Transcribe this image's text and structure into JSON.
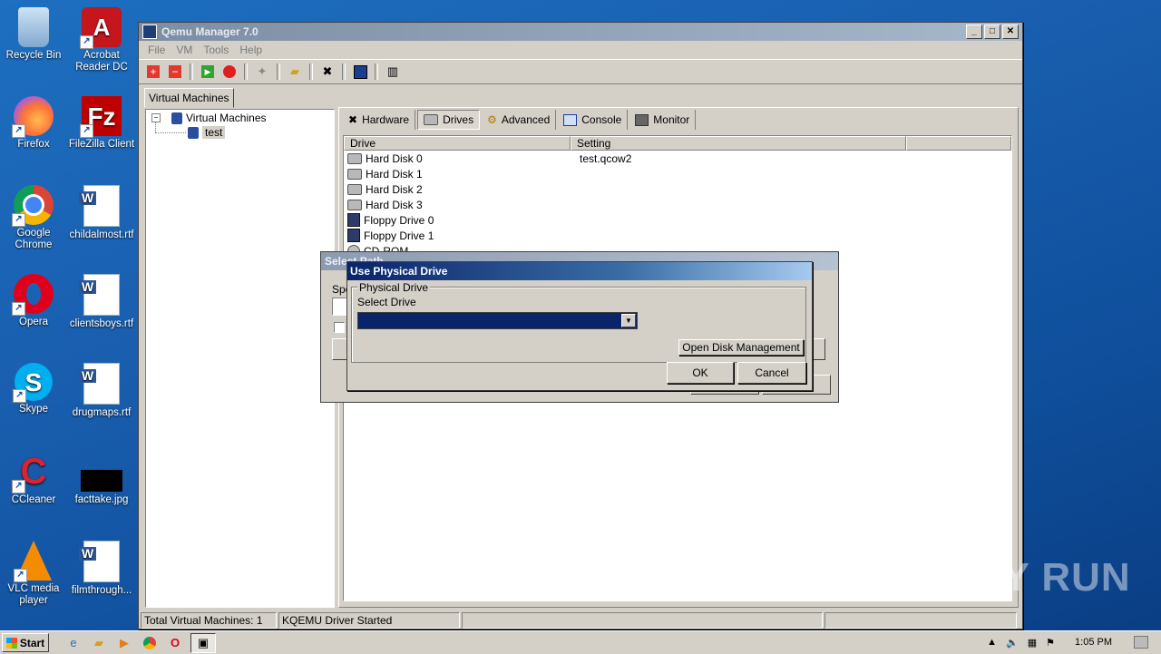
{
  "desktop": {
    "icons": [
      {
        "label": "Recycle Bin",
        "icon": "recycle-bin-icon"
      },
      {
        "label": "Acrobat Reader DC",
        "icon": "acrobat-icon"
      },
      {
        "label": "Firefox",
        "icon": "firefox-icon"
      },
      {
        "label": "FileZilla Client",
        "icon": "filezilla-icon"
      },
      {
        "label": "Google Chrome",
        "icon": "chrome-icon"
      },
      {
        "label": "childalmost.rtf",
        "icon": "word-doc-icon"
      },
      {
        "label": "Opera",
        "icon": "opera-icon"
      },
      {
        "label": "clientsboys.rtf",
        "icon": "word-doc-icon"
      },
      {
        "label": "Skype",
        "icon": "skype-icon"
      },
      {
        "label": "drugmaps.rtf",
        "icon": "word-doc-icon"
      },
      {
        "label": "CCleaner",
        "icon": "ccleaner-icon"
      },
      {
        "label": "facttake.jpg",
        "icon": "image-file-icon"
      },
      {
        "label": "VLC media player",
        "icon": "vlc-icon"
      },
      {
        "label": "filmthrough...",
        "icon": "word-doc-icon"
      }
    ]
  },
  "window": {
    "title": "Qemu Manager 7.0",
    "minimize": "_",
    "maximize": "□",
    "close": "✕",
    "menu": [
      "File",
      "VM",
      "Tools",
      "Help"
    ],
    "vm_tab": "Virtual Machines",
    "tree_root": "Virtual Machines",
    "tree_child": "test",
    "tabs": [
      "Hardware",
      "Drives",
      "Advanced",
      "Console",
      "Monitor"
    ],
    "active_tab": "Drives",
    "columns": [
      "Drive",
      "Setting",
      ""
    ],
    "rows": [
      {
        "drive": "Hard Disk 0",
        "setting": "test.qcow2",
        "type": "disk"
      },
      {
        "drive": "Hard Disk 1",
        "setting": "",
        "type": "disk"
      },
      {
        "drive": "Hard Disk 2",
        "setting": "",
        "type": "disk"
      },
      {
        "drive": "Hard Disk 3",
        "setting": "",
        "type": "disk"
      },
      {
        "drive": "Floppy Drive 0",
        "setting": "",
        "type": "floppy"
      },
      {
        "drive": "Floppy Drive 1",
        "setting": "",
        "type": "floppy"
      },
      {
        "drive": "CD-ROM",
        "setting": "",
        "type": "cd"
      }
    ],
    "status": [
      "Total Virtual Machines: 1",
      "KQEMU Driver Started",
      "",
      ""
    ]
  },
  "bg_dialog": {
    "title": "Select Path",
    "label_fragment": "Spe"
  },
  "dialog": {
    "title": "Use Physical Drive",
    "group_title": "Physical Drive",
    "select_label": "Select Drive",
    "selected_value": "",
    "open_disk_mgmt": "Open Disk Management",
    "ok": "OK",
    "cancel": "Cancel"
  },
  "taskbar": {
    "start": "Start",
    "clock": "1:05 PM"
  },
  "watermark": "ANY RUN"
}
